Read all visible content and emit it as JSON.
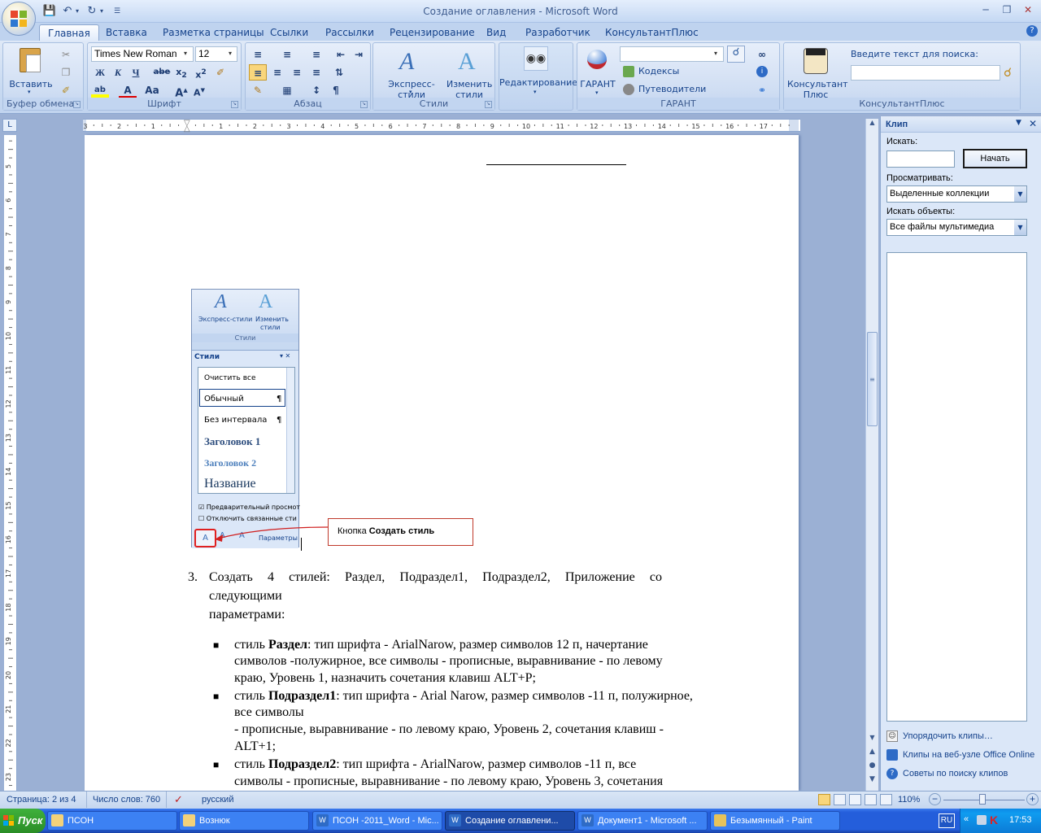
{
  "window": {
    "title": "Создание оглавления - Microsoft Word"
  },
  "tabs": [
    "Главная",
    "Вставка",
    "Разметка страницы",
    "Ссылки",
    "Рассылки",
    "Рецензирование",
    "Вид",
    "Разработчик",
    "КонсультантПлюс"
  ],
  "ribbon": {
    "clipboard": {
      "paste": "Вставить",
      "label": "Буфер обмена"
    },
    "font": {
      "name": "Times New Roman",
      "size": "12",
      "label": "Шрифт"
    },
    "paragraph": {
      "label": "Абзац"
    },
    "styles": {
      "express": "Экспресс-стили",
      "change": "Изменить",
      "change2": "стили",
      "label": "Стили"
    },
    "editing": {
      "label": "Редактирование"
    },
    "garant": {
      "btn": "ГАРАНТ",
      "codes": "Кодексы",
      "guides": "Путеводители",
      "label": "ГАРАНТ"
    },
    "consultant": {
      "btn1": "Консультант",
      "btn2": "Плюс",
      "search_caption": "Введите текст для поиска:",
      "label": "КонсультантПлюс"
    }
  },
  "document": {
    "item_number": "3.",
    "item_line1": [
      "Создать",
      "4",
      "стилей:",
      "Раздел,",
      "Подраздел1,",
      "Подраздел2,",
      "Приложение",
      "со"
    ],
    "item_line2": "следующими",
    "item_line3": "параметрами:",
    "callout": {
      "prefix": "Кнопка ",
      "bold": "Создать стиль"
    },
    "bullets": [
      {
        "lines": [
          {
            "pre": "стиль ",
            "bold": "Раздел",
            "post": ": тип шрифта - ArialNarow, размер символов 12 п, начертание"
          },
          {
            "text": "символов -полужирное, все символы - прописные, выравнивание - по левому"
          },
          {
            "text": "краю, Уровень 1, назначить сочетания клавиш ALT+P;"
          }
        ]
      },
      {
        "lines": [
          {
            "pre": "стиль ",
            "bold": "Подраздел1",
            "post": ": тип шрифта - Arial Narow, размер символов -11 п, полужирное,"
          },
          {
            "text": "все символы"
          },
          {
            "text": "- прописные, выравнивание - по левому краю, Уровень 2, сочетания клавиш -"
          },
          {
            "text": "ALT+1;"
          }
        ]
      },
      {
        "lines": [
          {
            "pre": "стиль ",
            "bold": "Подраздел2",
            "post": ":  тип шрифта - ArialNarow,  размер  символов -11  п,    все"
          },
          {
            "text": "символы - прописные, выравнивание - по левому краю, Уровень 3, сочетания"
          }
        ]
      }
    ]
  },
  "snapshot": {
    "express": "Экспресс-стили",
    "change1": "Изменить",
    "change2": "стили",
    "group": "Стили",
    "pane_title": "Стили",
    "items": [
      "Очистить все",
      "Обычный",
      "Без интервала",
      "Заголовок 1",
      "Заголовок 2",
      "Название"
    ],
    "check1": "Предварительный просмот",
    "check2": "Отключить связанные сти",
    "params": "Параметры"
  },
  "taskpane": {
    "title": "Клип",
    "search_label": "Искать:",
    "search_value": "",
    "start_btn": "Начать",
    "browse_label": "Просматривать:",
    "browse_value": "Выделенные коллекции",
    "objects_label": "Искать объекты:",
    "objects_value": "Все файлы мультимедиа",
    "links": [
      "Упорядочить клипы…",
      "Клипы на веб-узле Office Online",
      "Советы по поиску клипов"
    ]
  },
  "statusbar": {
    "page": "Страница: 2 из 4",
    "words": "Число слов: 760",
    "lang": "русский",
    "zoom": "110%"
  },
  "taskbar": {
    "start": "Пуск",
    "items": [
      "ПСОН",
      "Вознюк",
      "ПСОН -2011_Word - Mic...",
      "Создание оглавлени...",
      "Документ1 - Microsoft ...",
      "Безымянный - Paint"
    ],
    "lang": "RU",
    "time": "17:53"
  }
}
